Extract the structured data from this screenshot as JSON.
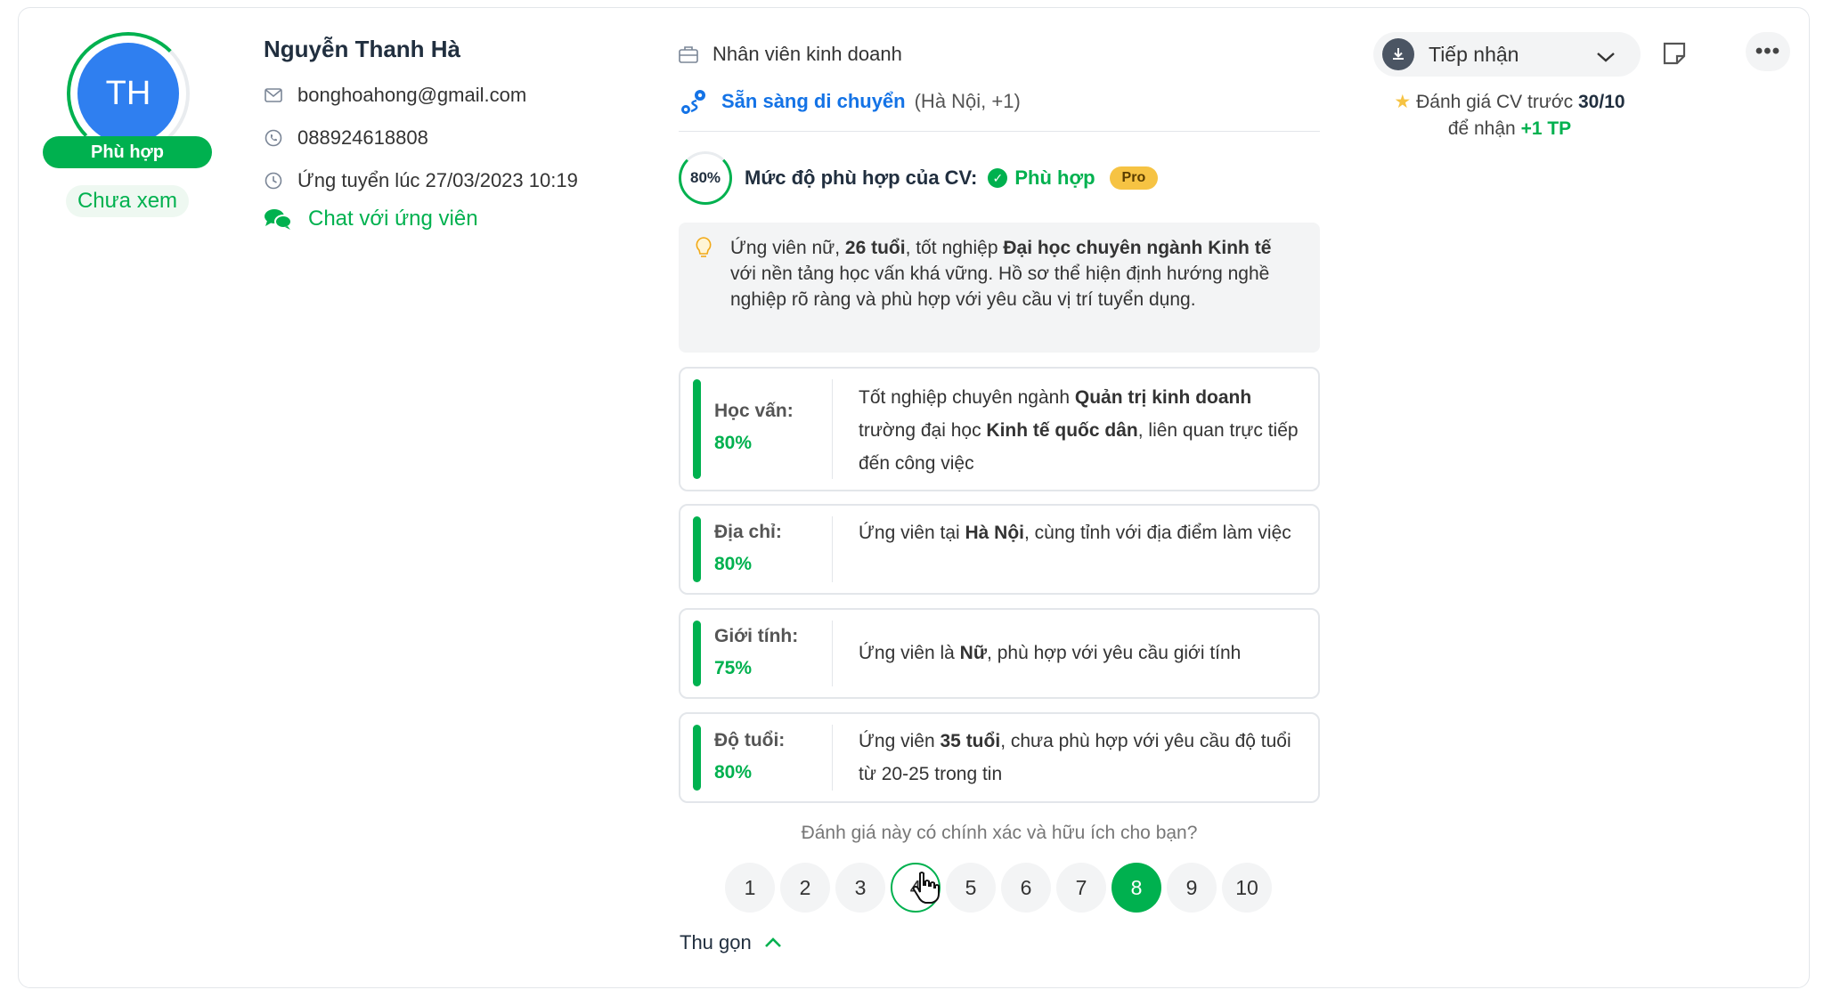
{
  "candidate": {
    "initials": "TH",
    "fit_badge": "Phù hợp",
    "seen_badge": "Chưa xem",
    "name": "Nguyễn Thanh Hà",
    "email": "bonghoahong@gmail.com",
    "phone": "088924618808",
    "applied_at": "Ứng tuyển lúc 27/03/2023 10:19",
    "chat_label": "Chat với ứng viên"
  },
  "job": {
    "title": "Nhân viên kinh doanh",
    "relocation_label": "Sẵn sàng di chuyển",
    "relocation_places": "(Hà Nội, +1)"
  },
  "match": {
    "score": "80%",
    "label": "Mức độ phù hợp của CV:",
    "status": "Phù hợp",
    "pro_badge": "Pro"
  },
  "summary": {
    "p1": "Ứng viên nữ, ",
    "b1": "26 tuổi",
    "p2": ", tốt nghiệp ",
    "b2": "Đại học chuyên ngành Kinh tế",
    "p3": " với nền tảng học vấn khá vững. Hồ sơ thể hiện định hướng nghề nghiệp rõ ràng và phù hợp với yêu cầu vị trí tuyển dụng."
  },
  "criteria": [
    {
      "label": "Học vấn:",
      "percent": "80%",
      "t1": "Tốt nghiệp chuyên ngành ",
      "b1": "Quản trị kinh doanh",
      "t2": " trường đại học ",
      "b2": "Kinh tế quốc dân",
      "t3": ", liên quan trực tiếp đến công việc"
    },
    {
      "label": "Địa chỉ:",
      "percent": "80%",
      "t1": "Ứng viên tại ",
      "b1": "Hà Nội",
      "t2": ", cùng tỉnh với địa điểm làm việc"
    },
    {
      "label": "Giới tính:",
      "percent": "75%",
      "t1": "Ứng viên là ",
      "b1": "Nữ",
      "t2": ", phù hợp với yêu cầu giới tính"
    },
    {
      "label": "Độ tuổi:",
      "percent": "80%",
      "t1": "Ứng viên ",
      "b1": "35 tuổi",
      "t2": ", chưa phù hợp với yêu cầu độ tuổi từ 20-25 trong tin"
    }
  ],
  "feedback": {
    "question": "Đánh giá này có chính xác và hữu ích cho bạn?",
    "options": [
      "1",
      "2",
      "3",
      "4",
      "5",
      "6",
      "7",
      "8",
      "9",
      "10"
    ],
    "selected": "8",
    "hovered": "4"
  },
  "collapse_label": "Thu gọn",
  "actions": {
    "status": "Tiếp nhận",
    "more": "•••"
  },
  "promo": {
    "text1": "Đánh giá CV trước ",
    "date": "30/10",
    "text2": "để nhận ",
    "reward": "+1 TP"
  },
  "colors": {
    "brand_green": "#00b14f",
    "avatar_blue": "#2f7ff0",
    "link_blue": "#1473e6",
    "pro_yellow": "#f6c343"
  }
}
